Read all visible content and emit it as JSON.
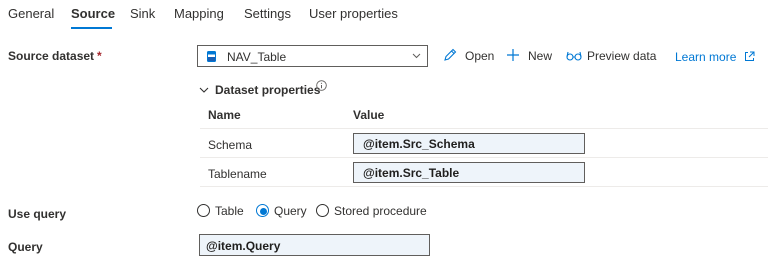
{
  "tabs": [
    "General",
    "Source",
    "Sink",
    "Mapping",
    "Settings",
    "User properties"
  ],
  "active_tab": "Source",
  "source_dataset": {
    "label": "Source dataset",
    "required_mark": "*",
    "selected": "NAV_Table",
    "actions": {
      "open": "Open",
      "new": "New",
      "preview": "Preview data"
    },
    "learn_more": "Learn more"
  },
  "dataset_properties": {
    "title": "Dataset properties",
    "columns": {
      "name": "Name",
      "value": "Value"
    },
    "rows": [
      {
        "name": "Schema",
        "value": "@item.Src_Schema"
      },
      {
        "name": "Tablename",
        "value": "@item.Src_Table"
      }
    ]
  },
  "use_query": {
    "label": "Use query",
    "options": [
      "Table",
      "Query",
      "Stored procedure"
    ],
    "selected": "Query"
  },
  "query": {
    "label": "Query",
    "value": "@item.Query"
  },
  "colors": {
    "accent": "#0078d4",
    "input_bg": "#eef4fa"
  }
}
